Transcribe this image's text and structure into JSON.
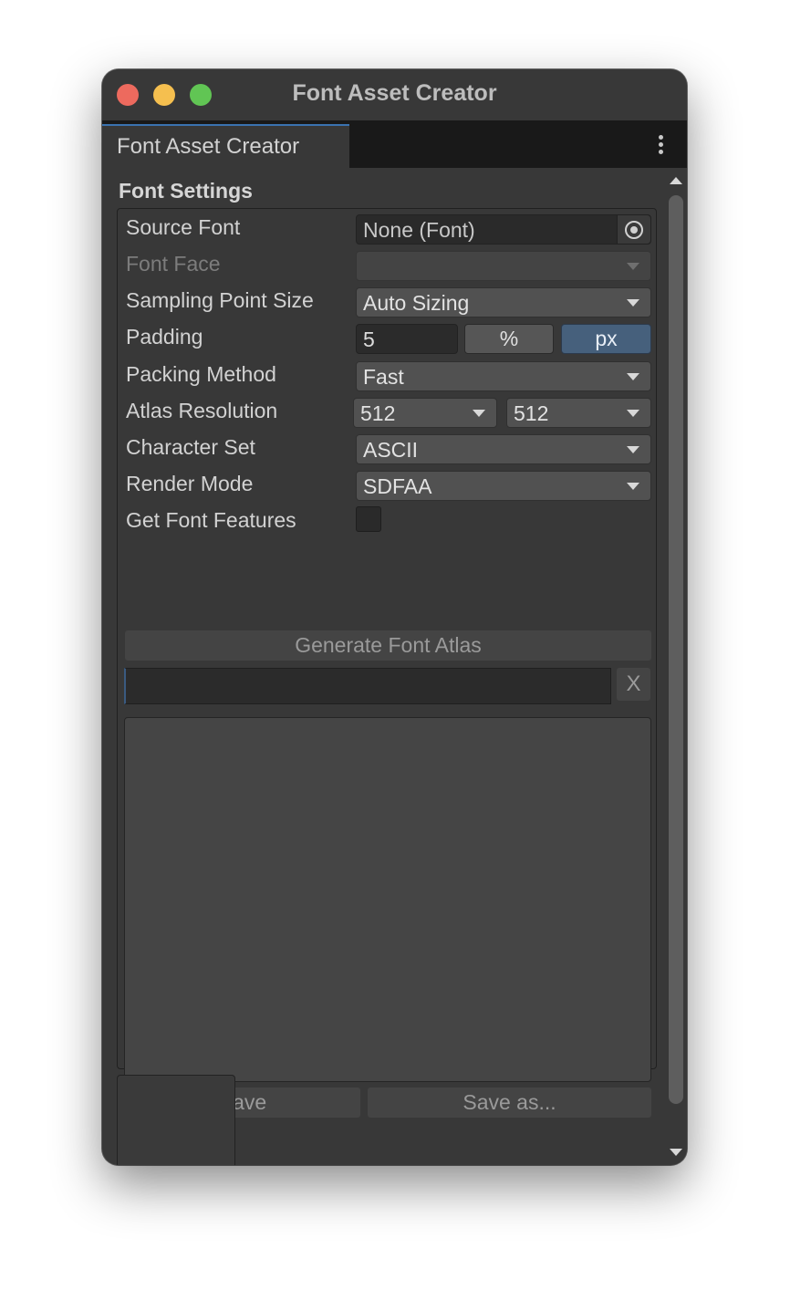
{
  "window": {
    "title": "Font Asset Creator",
    "tab_label": "Font Asset Creator",
    "traffic_lights": [
      "close",
      "minimize",
      "zoom"
    ]
  },
  "font_settings": {
    "section_title": "Font Settings",
    "source_font": {
      "label": "Source Font",
      "value": "None (Font)"
    },
    "font_face": {
      "label": "Font Face",
      "value": ""
    },
    "sampling_point_size": {
      "label": "Sampling Point Size",
      "value": "Auto Sizing"
    },
    "padding": {
      "label": "Padding",
      "value": "5",
      "unit_percent": "%",
      "unit_px": "px",
      "selected_unit": "px"
    },
    "packing_method": {
      "label": "Packing Method",
      "value": "Fast"
    },
    "atlas_resolution": {
      "label": "Atlas Resolution",
      "width": "512",
      "height": "512"
    },
    "character_set": {
      "label": "Character Set",
      "value": "ASCII"
    },
    "render_mode": {
      "label": "Render Mode",
      "value": "SDFAA"
    },
    "get_font_features": {
      "label": "Get Font Features",
      "checked": false
    }
  },
  "actions": {
    "generate_label": "Generate Font Atlas",
    "clear_label": "X",
    "save_label": "Save",
    "save_as_label": "Save as..."
  },
  "colors": {
    "window_bg": "#383838",
    "tab_bar_bg": "#191919",
    "accent_active": "#46607c",
    "close": "#ed6a5e",
    "minimize": "#f5bf4f",
    "zoom": "#61c554"
  },
  "icons": [
    "object-picker-icon",
    "dropdown-arrow-icon",
    "more-options-icon",
    "scroll-up-icon",
    "scroll-down-icon"
  ]
}
